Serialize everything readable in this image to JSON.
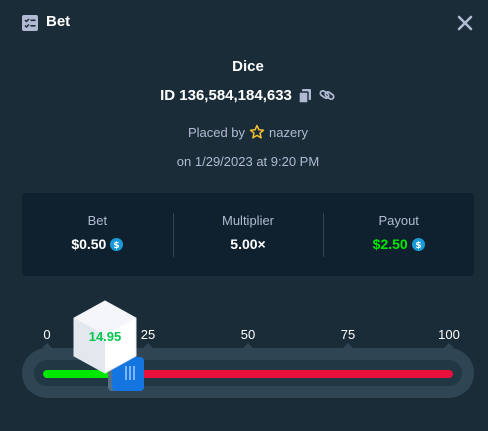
{
  "header": {
    "title": "Bet",
    "icon": "bet-list-icon",
    "close_icon": "close-icon"
  },
  "bet": {
    "game": "Dice",
    "id_label": "ID 136,584,184,633",
    "placed_by_label": "Placed by",
    "username": "nazery",
    "date_line": "on 1/29/2023 at 9:20 PM"
  },
  "stats": {
    "bet_label": "Bet",
    "bet_value": "$0.50",
    "multiplier_label": "Multiplier",
    "multiplier_value": "5.00×",
    "payout_label": "Payout",
    "payout_value": "$2.50"
  },
  "slider": {
    "ticks": [
      "0",
      "25",
      "50",
      "75",
      "100"
    ],
    "target": 19.8,
    "result": "14.95"
  },
  "colors": {
    "background": "#1a2c38",
    "panel": "#0f212e",
    "win": "#00e701",
    "lose": "#e9113c",
    "handle": "#1475e1",
    "coin": "#1a9bd8"
  }
}
